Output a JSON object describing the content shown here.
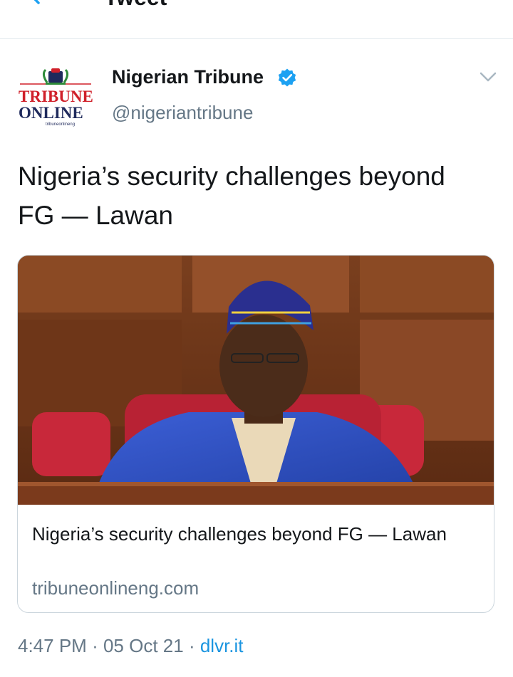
{
  "header": {
    "title": "Tweet",
    "back_icon": "arrow-left-icon"
  },
  "author": {
    "name": "Nigerian Tribune",
    "handle": "@nigeriantribune",
    "verified_icon": "verified-badge-icon",
    "avatar_logo_text": [
      "TRIBUNE",
      "ONLINE",
      "tribuneonlineng"
    ],
    "more_icon": "chevron-down-icon"
  },
  "tweet": {
    "text": "Nigeria’s security challenges beyond FG — Lawan"
  },
  "card": {
    "title": "Nigeria’s security challenges beyond FG — Lawan",
    "domain": "tribuneonlineng.com"
  },
  "meta": {
    "time": "4:47 PM",
    "separator": "·",
    "date": "05 Oct 21",
    "source": "dlvr.it"
  },
  "colors": {
    "accent": "#1b95e0",
    "verified": "#1da1f2",
    "secondary_text": "#657786",
    "border": "#e1e8ed",
    "logo_red": "#d0202a",
    "logo_navy": "#1f2a5c"
  }
}
